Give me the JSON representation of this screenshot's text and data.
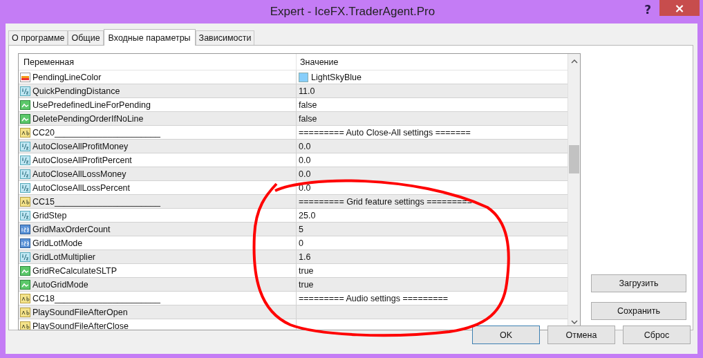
{
  "window": {
    "title": "Expert - IceFX.TraderAgent.Pro",
    "help": "?",
    "close": "×"
  },
  "tabs": [
    {
      "label": "О программе",
      "selected": false
    },
    {
      "label": "Общие",
      "selected": false
    },
    {
      "label": "Входные параметры",
      "selected": true
    },
    {
      "label": "Зависимости",
      "selected": false
    }
  ],
  "table": {
    "columns": [
      "Переменная",
      "Значение"
    ],
    "rows": [
      {
        "kind": "color",
        "name": "PendingLineColor",
        "value": "LightSkyBlue",
        "color": "#87cefa"
      },
      {
        "kind": "double",
        "name": "QuickPendingDistance",
        "value": "11.0"
      },
      {
        "kind": "bool",
        "name": "UsePredefinedLineForPending",
        "value": "false"
      },
      {
        "kind": "bool",
        "name": "DeletePendingOrderIfNoLine",
        "value": "false"
      },
      {
        "kind": "string",
        "name": "CC20______________________",
        "value": "========= Auto Close-All settings ======="
      },
      {
        "kind": "double",
        "name": "AutoCloseAllProfitMoney",
        "value": "0.0"
      },
      {
        "kind": "double",
        "name": "AutoCloseAllProfitPercent",
        "value": "0.0"
      },
      {
        "kind": "double",
        "name": "AutoCloseAllLossMoney",
        "value": "0.0"
      },
      {
        "kind": "double",
        "name": "AutoCloseAllLossPercent",
        "value": "0.0"
      },
      {
        "kind": "string",
        "name": "CC15______________________",
        "value": "========= Grid feature settings ========="
      },
      {
        "kind": "double",
        "name": "GridStep",
        "value": "25.0"
      },
      {
        "kind": "int",
        "name": "GridMaxOrderCount",
        "value": "5"
      },
      {
        "kind": "int",
        "name": "GridLotMode",
        "value": "0"
      },
      {
        "kind": "double",
        "name": "GridLotMultiplier",
        "value": "1.6"
      },
      {
        "kind": "bool",
        "name": "GridReCalculateSLTP",
        "value": "true"
      },
      {
        "kind": "bool",
        "name": "AutoGridMode",
        "value": "true"
      },
      {
        "kind": "string",
        "name": "CC18______________________",
        "value": "========= Audio settings ========="
      },
      {
        "kind": "string",
        "name": "PlaySoundFileAfterOpen"
      },
      {
        "kind": "string",
        "name": "PlaySoundFileAfterClose"
      }
    ]
  },
  "side_buttons": [
    "Загрузить",
    "Сохранить"
  ],
  "buttons": [
    {
      "label": "OK",
      "selected": true
    },
    {
      "label": "Отмена",
      "selected": false
    },
    {
      "label": "Сброс",
      "selected": false
    }
  ]
}
